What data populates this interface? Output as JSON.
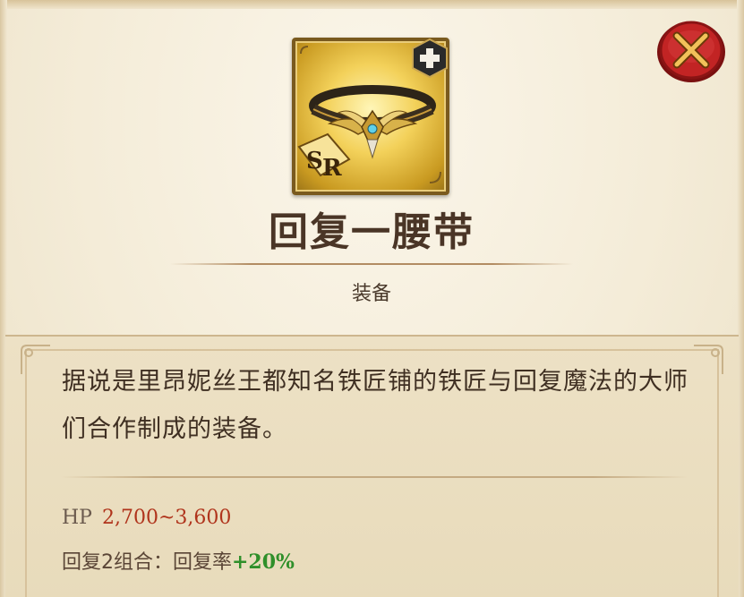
{
  "item": {
    "name": "回复一腰带",
    "type": "装备",
    "rarity": "SR",
    "description": "据说是里昂妮丝王都知名铁匠铺的铁匠与回复魔法的大师们合作制成的装备。",
    "icon": "gold-winged-belt-icon"
  },
  "stats": {
    "hp_label": "HP",
    "hp_value": "2,700~3,600",
    "set_label": "回复2组合：回复率",
    "set_value": "+20%"
  },
  "buttons": {
    "close_icon": "close-x-icon",
    "plus_icon": "plus-icon"
  },
  "colors": {
    "title": "#4a3526",
    "hp_value": "#b0341c",
    "set_value": "#2f8f2a",
    "close_button": "#b81d1d"
  }
}
